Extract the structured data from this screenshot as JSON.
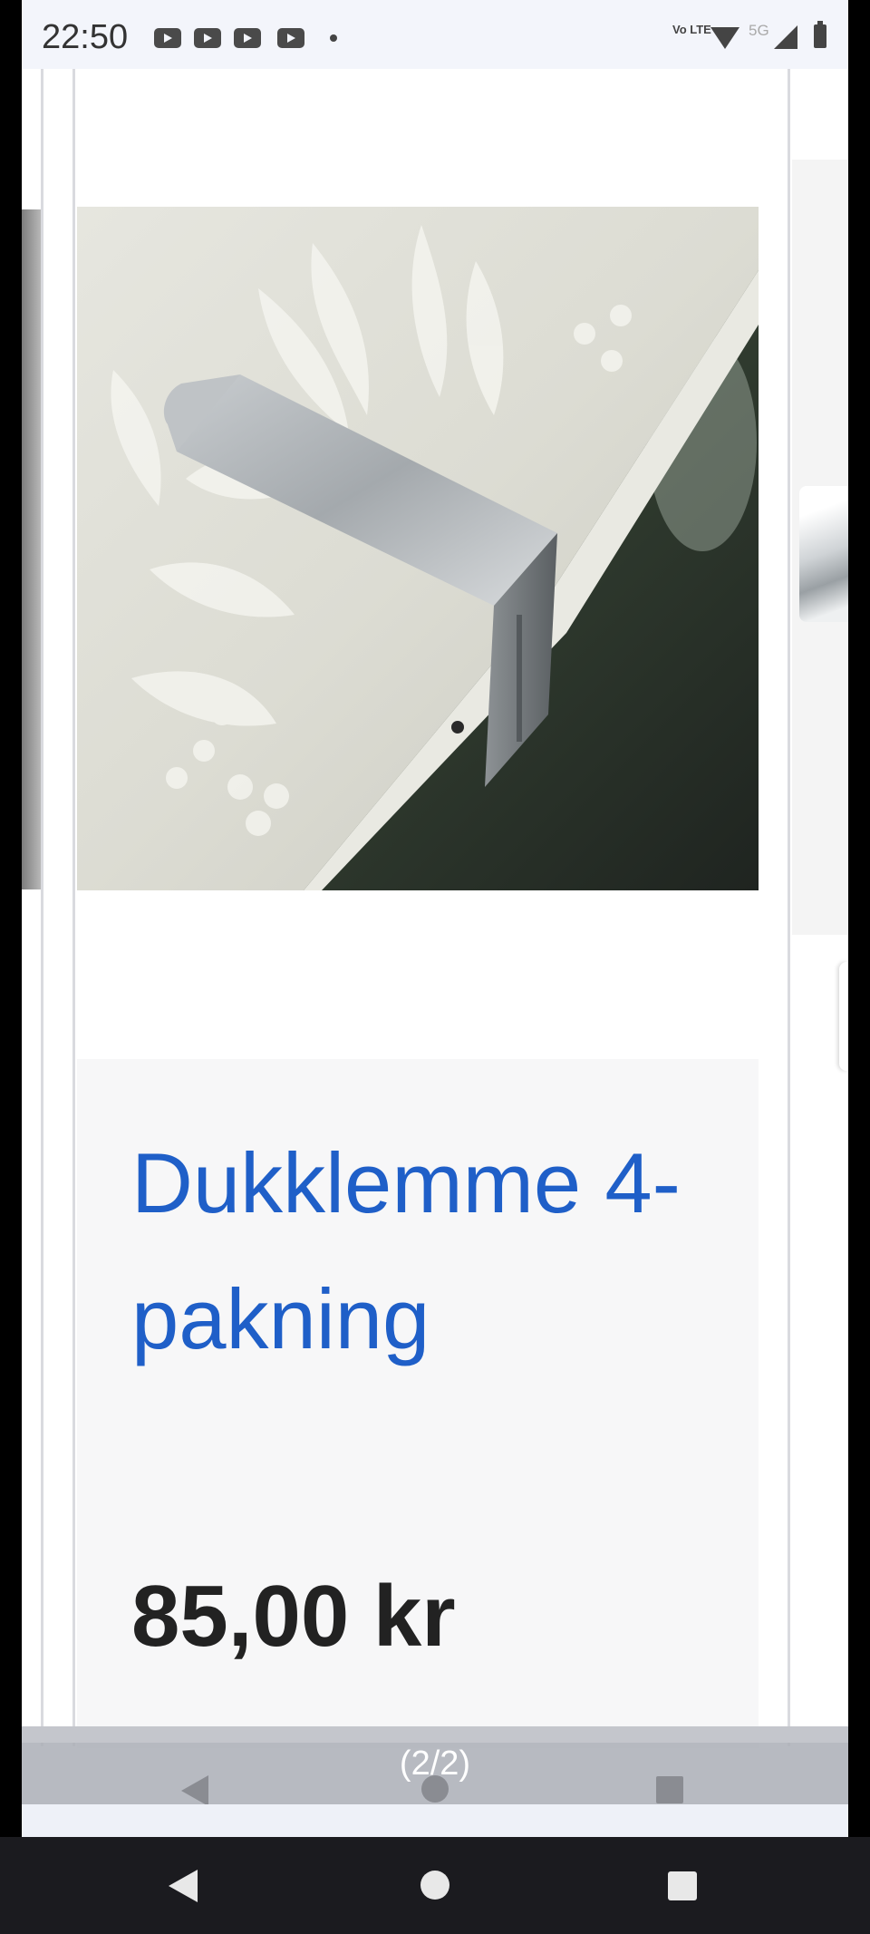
{
  "status_bar": {
    "time": "22:50",
    "notification_icons": [
      "news-icon",
      "youtube-icon",
      "youtube-music-icon",
      "video-icon"
    ],
    "volte_label": "Vo LTE",
    "network_label": "5G"
  },
  "product": {
    "title": "Dukklemme 4-pakning",
    "price": "85,00 kr",
    "image_alt": "Stainless steel tablecloth clip on damask tablecloth"
  },
  "carousel": {
    "counter": "(2/2)"
  },
  "colors": {
    "title": "#1f5fc8",
    "price": "#222222",
    "info_background": "#f7f7f8"
  }
}
